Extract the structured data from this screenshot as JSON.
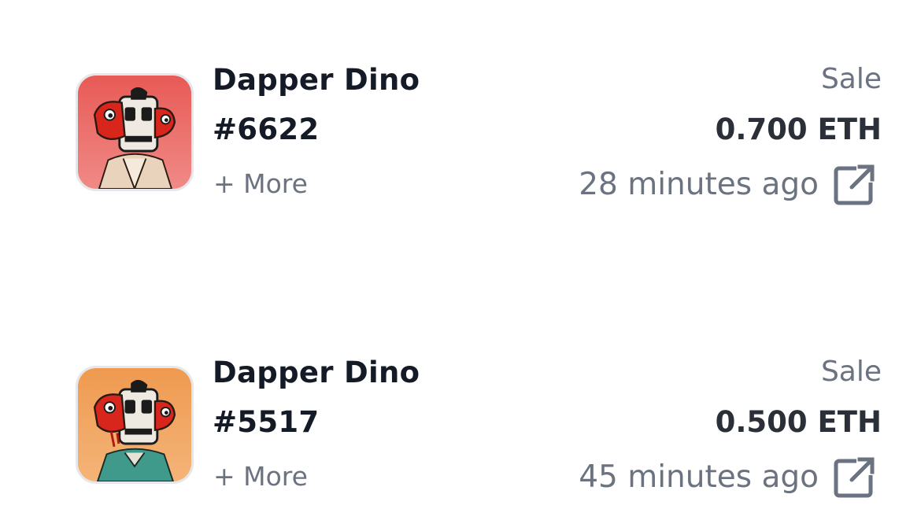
{
  "colors": {
    "name_text": "#141a26",
    "secondary_text": "#6b7280",
    "price_text": "#2a2f38",
    "thumb_border": "#e5e7eb",
    "thumb_bg_red": "#ef6b68",
    "thumb_bg_orange": "#f2a462"
  },
  "activities": [
    {
      "collection": "Dapper Dino",
      "token": "#6622",
      "more_label": "+ More",
      "event_type": "Sale",
      "price": "0.700 ETH",
      "time_ago": "28 minutes ago",
      "link_icon": "external-link-icon",
      "thumbnail_icon": "dapper-dino-nft-image"
    },
    {
      "collection": "Dapper Dino",
      "token": "#5517",
      "more_label": "+ More",
      "event_type": "Sale",
      "price": "0.500 ETH",
      "time_ago": "45 minutes ago",
      "link_icon": "external-link-icon",
      "thumbnail_icon": "dapper-dino-nft-image"
    }
  ]
}
